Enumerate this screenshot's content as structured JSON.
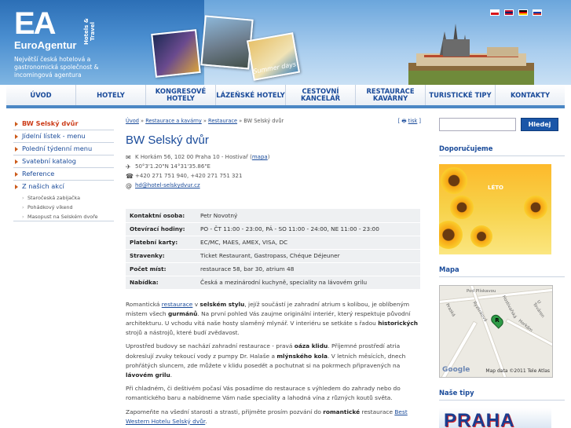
{
  "header": {
    "logo_letters": "EA",
    "logo_side": "Hotels & Travel",
    "brand": "EuroAgentur",
    "tagline": "Největší česká hotelová a gastronomická společnost & incomingová agentura",
    "summer_caption": "Summer days",
    "flags": [
      {
        "name": "flag-cz",
        "colors": [
          "#ffffff",
          "#d7141a",
          "#11457e"
        ]
      },
      {
        "name": "flag-en",
        "colors": [
          "#012169",
          "#c8102e",
          "#ffffff"
        ]
      },
      {
        "name": "flag-de",
        "colors": [
          "#000000",
          "#dd0000",
          "#ffce00"
        ]
      },
      {
        "name": "flag-ru",
        "colors": [
          "#ffffff",
          "#0039a6",
          "#d52b1e"
        ]
      }
    ]
  },
  "nav": [
    "ÚVOD",
    "HOTELY",
    "KONGRESOVÉ HOTELY",
    "LÁZEŇSKÉ HOTELY",
    "CESTOVNÍ KANCELÁŘ",
    "RESTAURACE KAVÁRNY",
    "TURISTICKÉ TIPY",
    "KONTAKTY"
  ],
  "leftmenu": {
    "items": [
      "BW Selský dvůr",
      "Jídelní lístek - menu",
      "Polední týdenní menu",
      "Svatební katalog",
      "Reference",
      "Z našich akcí"
    ],
    "subitems": [
      "Staročeská zabijačka",
      "Pohádkový víkend",
      "Masopust na Selském dvoře"
    ]
  },
  "breadcrumb": {
    "home": "Úvod",
    "sep": " » ",
    "b1": "Restaurace a kavárny",
    "b2": "Restaurace",
    "current": "BW Selský dvůr"
  },
  "print_label": "tisk",
  "page_title": "BW Selský dvůr",
  "contact": {
    "address": "K Horkám 56, 102 00 Praha 10 - Hostivař",
    "map_link": "mapa",
    "gps": "50°3'1.20\"N   14°31'35.86\"E",
    "phone": "+420 271 751 940, +420 271 751 321",
    "email": "hd@hotel-selskydvur.cz"
  },
  "info_table": [
    {
      "k": "Kontaktní osoba:",
      "v": "Petr Novotný"
    },
    {
      "k": "Otevírací hodiny:",
      "v": "PO - ČT 11:00 - 23:00, PÁ - SO 11:00 - 24:00, NE 11:00 - 23:00"
    },
    {
      "k": "Platební karty:",
      "v": "EC/MC, MAES, AMEX, VISA, DC"
    },
    {
      "k": "Stravenky:",
      "v": "Ticket Restaurant, Gastropass, Chéque Déjeuner"
    },
    {
      "k": "Počet míst:",
      "v": "restaurace 58, bar 30, atrium 48"
    },
    {
      "k": "Nabídka:",
      "v": "Česká a mezinárodní kuchyně, speciality na lávovém grilu"
    }
  ],
  "desc": {
    "p1_a": "Romantická ",
    "p1_link": "restaurace",
    "p1_b": " v ",
    "p1_bold1": "selském stylu",
    "p1_c": ", jejíž součástí je zahradní atrium s kolibou, je oblíbeným místem všech ",
    "p1_bold2": "gurmánů",
    "p1_d": ". Na první pohled Vás zaujme originální interiér, který respektuje původní architekturu. U vchodu vítá naše hosty slaměný mlynář. V interiéru se setkáte s řadou ",
    "p1_bold3": "historických",
    "p1_e": " strojů a nástrojů, které budí zvědavost.",
    "p2_a": "Uprostřed budovy se nachází zahradní restaurace - pravá ",
    "p2_bold1": "oáza klidu",
    "p2_b": ". Příjemné prostředí atria dokreslují zvuky tekoucí vody z pumpy Dr. Halaše a ",
    "p2_bold2": "mlýnského kola",
    "p2_c": ". V letních měsících, dnech prohřátých sluncem, zde můžete v klidu posedět a pochutnat si na pokrmech připravených na ",
    "p2_bold3": "lávovém grilu",
    "p2_d": ".",
    "p3_a": "Při chladném, či deštivém počasí Vás posadíme do restaurace s výhledem do zahrady nebo do romantického baru a nabídneme Vám naše speciality a lahodná vína z různých koutů světa.",
    "p4_a": "Zapomeňte na všední starosti a strasti, přijměte prosím pozvání do ",
    "p4_bold": "romantické",
    "p4_b": " restaurace ",
    "p4_link": "Best Western Hotelu Selský dvůr",
    "p4_c": "."
  },
  "right": {
    "search_placeholder": "",
    "search_button": "Hledej",
    "recommended": "Doporučujeme",
    "promo_label": "LÉTO",
    "map_heading": "Mapa",
    "map_labels": [
      "Pod Plískavou",
      "Hostivařská",
      "Praská",
      "Ryzlinková",
      "Horkám",
      "U Továren"
    ],
    "map_pin": "R",
    "google": "Google",
    "map_copyright": "Map data ©2011 Tele Atlas",
    "tips": "Naše tipy",
    "praha": "PRAHA"
  }
}
